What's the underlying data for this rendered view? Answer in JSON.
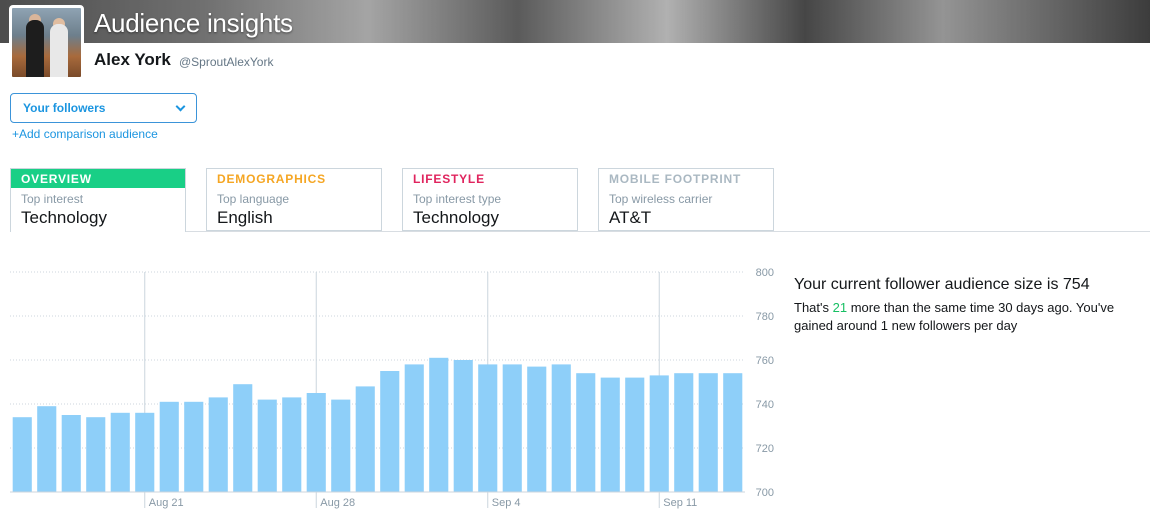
{
  "header": {
    "title": "Audience insights",
    "user_name": "Alex York",
    "user_handle": "@SproutAlexYork"
  },
  "audience": {
    "selected": "Your followers",
    "add_comparison": "+Add comparison audience"
  },
  "tabs": [
    {
      "label": "OVERVIEW",
      "sublabel": "Top interest",
      "value": "Technology",
      "color": "#ffffff",
      "bg": "#19cf86",
      "active": true
    },
    {
      "label": "DEMOGRAPHICS",
      "sublabel": "Top language",
      "value": "English",
      "color": "#f5a623",
      "active": false
    },
    {
      "label": "LIFESTYLE",
      "sublabel": "Top interest type",
      "value": "Technology",
      "color": "#e0245e",
      "active": false
    },
    {
      "label": "MOBILE FOOTPRINT",
      "sublabel": "Top wireless carrier",
      "value": "AT&T",
      "color": "#aab8c2",
      "active": false
    }
  ],
  "summary": {
    "title_prefix": "Your current follower audience size is ",
    "size": "754",
    "line_prefix": "That's ",
    "delta": "21",
    "line_suffix": " more than the same time 30 days ago. You've gained around 1 new followers per day"
  },
  "colors": {
    "bar": "#8ecff9",
    "accent": "#1b95e0",
    "grid": "#ccd6dd"
  },
  "chart_data": {
    "type": "bar",
    "ylim": [
      700,
      800
    ],
    "yticks": [
      700,
      720,
      740,
      760,
      780,
      800
    ],
    "xtick_labels": [
      {
        "label": "Aug 21",
        "index": 5.5
      },
      {
        "label": "Aug 28",
        "index": 12.5
      },
      {
        "label": "Sep 4",
        "index": 19.5
      },
      {
        "label": "Sep 11",
        "index": 26.5
      }
    ],
    "values": [
      734,
      739,
      735,
      734,
      736,
      736,
      741,
      741,
      743,
      749,
      742,
      743,
      745,
      742,
      748,
      755,
      758,
      761,
      760,
      758,
      758,
      757,
      758,
      754,
      752,
      752,
      753,
      754,
      754,
      754
    ]
  }
}
